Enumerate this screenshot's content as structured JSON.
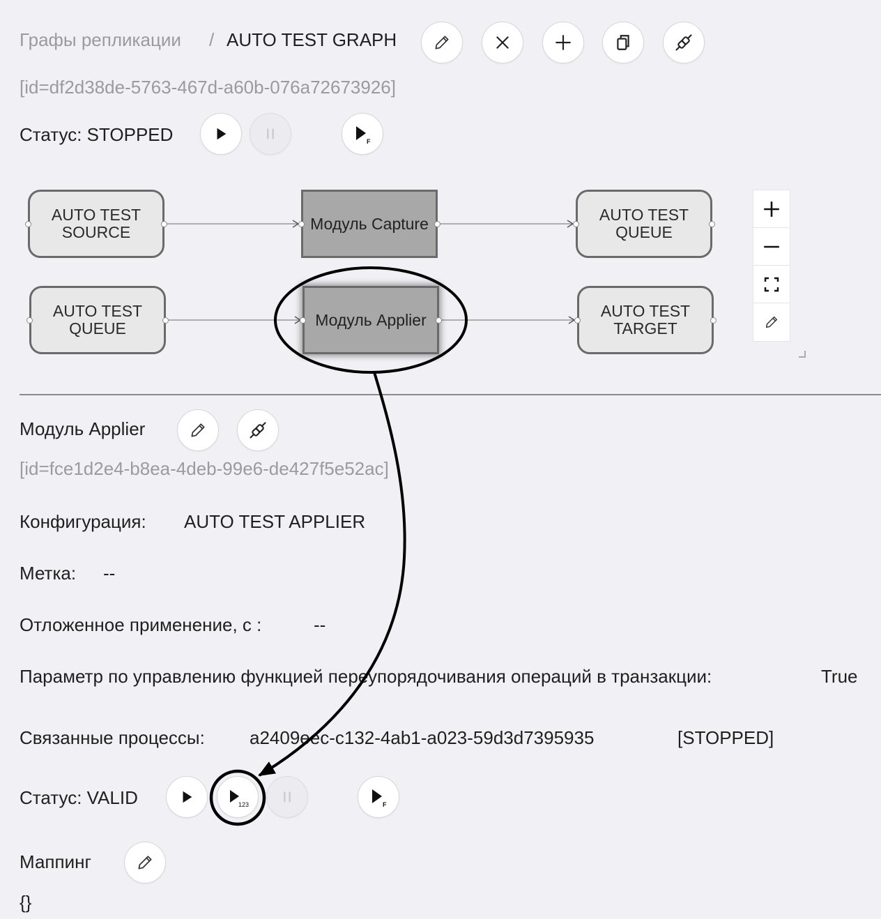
{
  "breadcrumb": {
    "parent": "Графы репликации",
    "separator": "/",
    "current": "AUTO TEST GRAPH"
  },
  "graph": {
    "id_text": "[id=df2d38de-5763-467d-a60b-076a72673926]",
    "status_text": "Статус: STOPPED",
    "icons": [
      "pencil-icon",
      "close-icon",
      "plus-icon",
      "copy-icon",
      "plug-icon"
    ]
  },
  "diagram": {
    "row1": {
      "source": "AUTO TEST SOURCE",
      "module": "Модуль Capture",
      "target": "AUTO TEST QUEUE"
    },
    "row2": {
      "source": "AUTO TEST QUEUE",
      "module": "Модуль Applier",
      "target": "AUTO TEST TARGET"
    },
    "zoom_controls": [
      "zoom-in-icon",
      "zoom-out-icon",
      "fit-view-icon",
      "edit-icon"
    ],
    "highlight": "Модуль Applier"
  },
  "module": {
    "title": "Модуль Applier",
    "id_text": "[id=fce1d2e4-b8ea-4deb-99e6-de427f5e52ac]",
    "config_label": "Конфигурация:",
    "config_value": "AUTO TEST APPLIER",
    "label_label": "Метка:",
    "label_value": "--",
    "delay_label": "Отложенное применение, с :",
    "delay_value": "--",
    "reorder_label": "Параметр по управлению функцией переупорядочивания операций в транзакции:",
    "reorder_value": "True",
    "processes_label": "Связанные процессы:",
    "processes_value": "a2409eec-c132-4ab1-a023-59d3d7395935",
    "processes_status": "[STOPPED]",
    "status_text": "Статус: VALID",
    "run_n_sub": "123",
    "run_f_sub": "F",
    "mapping_label": "Маппинг",
    "mapping_value": "{}"
  },
  "colors": {
    "background": "#f1f1f5",
    "module_fill": "#a8a8a8",
    "node_fill": "#e8e8e8",
    "muted_text": "#9a9a9f"
  }
}
